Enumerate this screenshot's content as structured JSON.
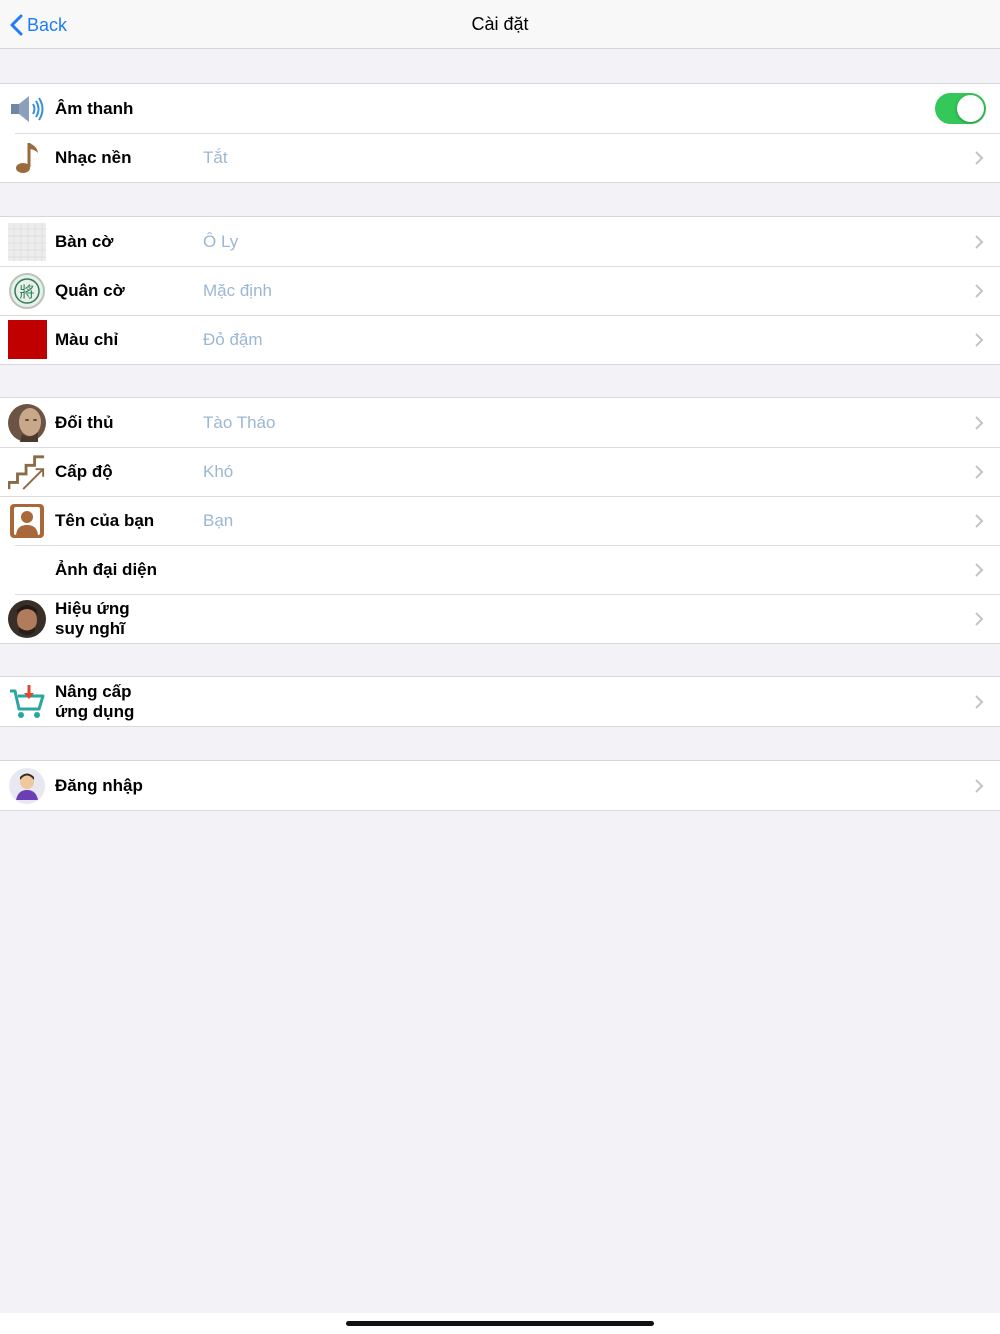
{
  "navbar": {
    "back_label": "Back",
    "title": "Cài đặt"
  },
  "sections": [
    {
      "rows": [
        {
          "label": "Âm thanh",
          "value": "",
          "icon": "speaker-icon",
          "toggle_on": true
        },
        {
          "label": "Nhạc nền",
          "value": "Tắt",
          "icon": "music-note-icon"
        }
      ]
    },
    {
      "rows": [
        {
          "label": "Bàn cờ",
          "value": "Ô Ly",
          "icon": "board-grid-icon"
        },
        {
          "label": "Quân cờ",
          "value": "Mặc định",
          "icon": "chess-piece-icon"
        },
        {
          "label": "Màu chỉ",
          "value": "Đỏ đậm",
          "icon": "color-swatch-icon"
        }
      ]
    },
    {
      "rows": [
        {
          "label": "Đối thủ",
          "value": "Tào Tháo",
          "icon": "opponent-avatar-icon"
        },
        {
          "label": "Cấp độ",
          "value": "Khó",
          "icon": "stairs-icon"
        },
        {
          "label": "Tên của bạn",
          "value": "Bạn",
          "icon": "contact-icon"
        },
        {
          "label": "Ảnh đại diện",
          "value": "",
          "icon": ""
        },
        {
          "label": "Hiệu ứng suy nghĩ",
          "value": "",
          "icon": "thinking-avatar-icon"
        }
      ]
    },
    {
      "rows": [
        {
          "label": "Nâng cấp ứng dụng",
          "value": "",
          "icon": "cart-icon"
        }
      ]
    },
    {
      "rows": [
        {
          "label": "Đăng nhập",
          "value": "",
          "icon": "user-icon"
        }
      ]
    }
  ],
  "colors": {
    "accent": "#1f7cf2",
    "toggle_on": "#34c759",
    "value_text": "#9cb7d4",
    "swatch": "#c00000"
  }
}
